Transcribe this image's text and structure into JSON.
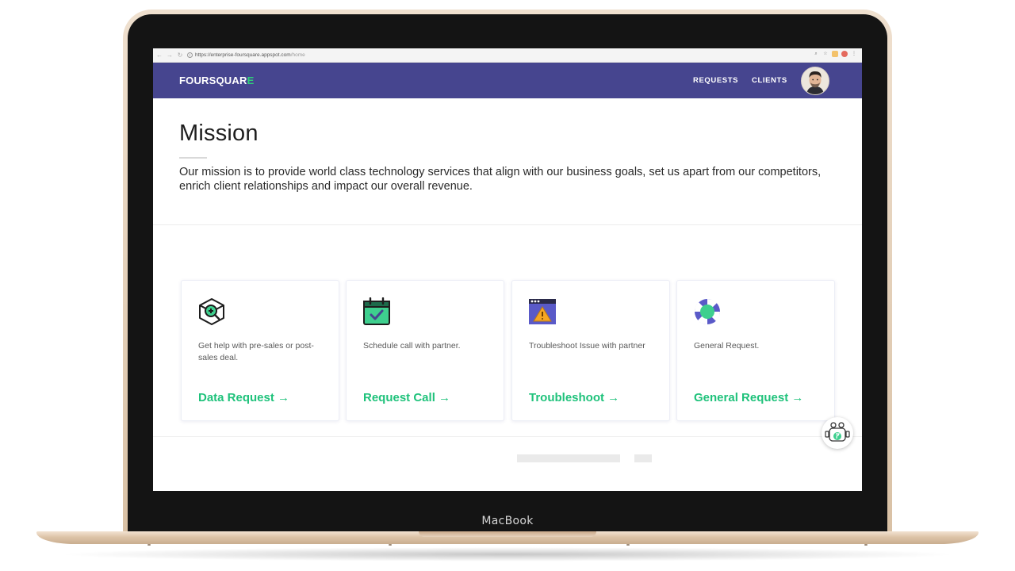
{
  "device": {
    "label": "MacBook"
  },
  "browser": {
    "url_host": "https://enterprise-foursquare.appspot.com",
    "url_path": "/home",
    "nav_icons": [
      "back-icon",
      "forward-icon",
      "reload-icon"
    ],
    "toolbar_icons": [
      "zoom-icon",
      "star-icon",
      "extension-icon",
      "extension-icon",
      "menu-icon"
    ]
  },
  "header": {
    "logo_main": "FOURSQUAR",
    "logo_accent": "E",
    "nav": [
      {
        "label": "REQUESTS"
      },
      {
        "label": "CLIENTS"
      }
    ],
    "colors": {
      "bar": "#46458f",
      "accent": "#2fd07a"
    }
  },
  "mission": {
    "title": "Mission",
    "body": "Our mission is to provide world class technology services that align with our business goals, set us apart from our competitors, enrich client relationships and impact our overall revenue."
  },
  "cards": [
    {
      "icon": "magnify-cube-icon",
      "description": "Get help with pre-sales or post-sales deal.",
      "action": "Data Request →"
    },
    {
      "icon": "calendar-check-icon",
      "description": "Schedule call with partner.",
      "action": "Request Call →"
    },
    {
      "icon": "warning-window-icon",
      "description": "Troubleshoot Issue with partner",
      "action": "Troubleshoot →"
    },
    {
      "icon": "lifebuoy-icon",
      "description": "General Request.",
      "action": "General Request →"
    }
  ],
  "cta_color": "#1fc27b",
  "chatbot": {
    "icon": "robot-icon"
  }
}
